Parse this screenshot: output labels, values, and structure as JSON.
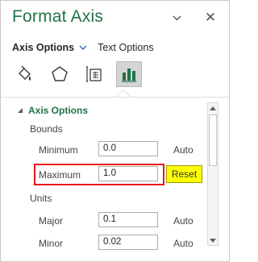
{
  "pane": {
    "title": "Format Axis",
    "pin_icon": "chevron-down-icon",
    "close_icon": "close-icon",
    "close_glyph": "✕"
  },
  "tabs": {
    "active": "Axis Options",
    "other": "Text Options"
  },
  "icon_tabs": [
    {
      "name": "fill-line-icon",
      "selected": false
    },
    {
      "name": "effects-icon",
      "selected": false
    },
    {
      "name": "size-properties-icon",
      "selected": false
    },
    {
      "name": "axis-options-icon",
      "selected": true
    }
  ],
  "section": {
    "title": "Axis Options",
    "bounds_label": "Bounds",
    "units_label": "Units"
  },
  "fields": {
    "minimum": {
      "label": "Minimum",
      "value": "0.0",
      "auto": "Auto"
    },
    "maximum": {
      "label": "Maximum",
      "value": "1.0",
      "reset": "Reset"
    },
    "major": {
      "label": "Major",
      "value": "0.1",
      "auto": "Auto"
    },
    "minor": {
      "label": "Minor",
      "value": "0.02",
      "auto": "Auto"
    }
  },
  "colors": {
    "accent": "#217346",
    "highlight_border": "#e8161d",
    "reset_bg": "#ffff00",
    "selected_tab_bg": "#d4d4d4"
  }
}
